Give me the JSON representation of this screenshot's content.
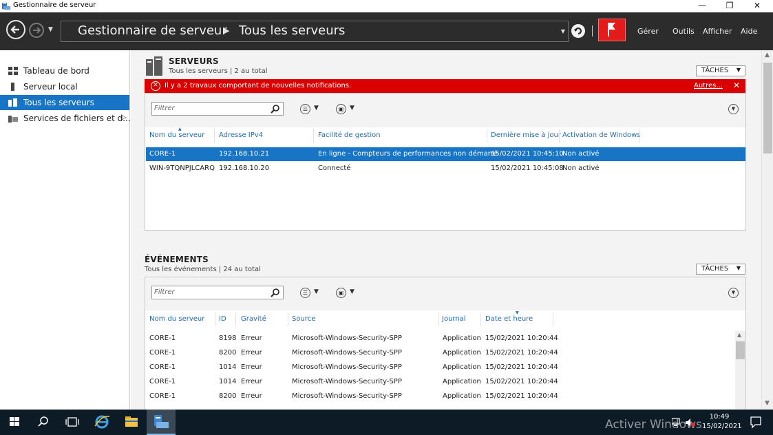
{
  "window": {
    "title": "Gestionnaire de serveur",
    "controls": {
      "minimize": "—",
      "maximize": "❐",
      "close": "✕"
    }
  },
  "header": {
    "breadcrumb": [
      "Gestionnaire de serveur",
      "Tous les serveurs"
    ],
    "menu": [
      "Gérer",
      "Outils",
      "Afficher",
      "Aide"
    ]
  },
  "sidebar": {
    "items": [
      {
        "label": "Tableau de bord",
        "icon": "dashboard-icon",
        "active": false
      },
      {
        "label": "Serveur local",
        "icon": "server-icon",
        "active": false
      },
      {
        "label": "Tous les serveurs",
        "icon": "servers-icon",
        "active": true
      },
      {
        "label": "Services de fichiers et d...",
        "icon": "file-services-icon",
        "active": false,
        "expandable": true
      }
    ]
  },
  "servers": {
    "title": "SERVEURS",
    "subtitle": "Tous les serveurs | 2 au total",
    "tasks_label": "TÂCHES",
    "alert": {
      "message": "Il y a 2 travaux comportant de nouvelles notifications.",
      "more": "Autres...",
      "close": "✕"
    },
    "filter_placeholder": "Filtrer",
    "columns": [
      "Nom du serveur",
      "Adresse IPv4",
      "Facilité de gestion",
      "Dernière mise à jour",
      "Activation de Windows"
    ],
    "rows": [
      {
        "name": "CORE-1",
        "ip": "192.168.10.21",
        "manageability": "En ligne - Compteurs de performances non démarré",
        "updated": "15/02/2021 10:45:10",
        "activation": "Non activé",
        "selected": true
      },
      {
        "name": "WIN-9TQNPJLCARQ",
        "ip": "192.168.10.20",
        "manageability": "Connecté",
        "updated": "15/02/2021 10:45:08",
        "activation": "Non activé",
        "selected": false
      }
    ]
  },
  "events": {
    "title": "ÉVÉNEMENTS",
    "subtitle": "Tous les événements | 24 au total",
    "tasks_label": "TÂCHES",
    "filter_placeholder": "Filtrer",
    "columns": [
      "Nom du serveur",
      "ID",
      "Gravité",
      "Source",
      "Journal",
      "Date et heure"
    ],
    "rows": [
      {
        "name": "CORE-1",
        "id": "8198",
        "severity": "Erreur",
        "source": "Microsoft-Windows-Security-SPP",
        "log": "Application",
        "date": "15/02/2021 10:20:44"
      },
      {
        "name": "CORE-1",
        "id": "8200",
        "severity": "Erreur",
        "source": "Microsoft-Windows-Security-SPP",
        "log": "Application",
        "date": "15/02/2021 10:20:44"
      },
      {
        "name": "CORE-1",
        "id": "1014",
        "severity": "Erreur",
        "source": "Microsoft-Windows-Security-SPP",
        "log": "Application",
        "date": "15/02/2021 10:20:44"
      },
      {
        "name": "CORE-1",
        "id": "1014",
        "severity": "Erreur",
        "source": "Microsoft-Windows-Security-SPP",
        "log": "Application",
        "date": "15/02/2021 10:20:44"
      },
      {
        "name": "CORE-1",
        "id": "8200",
        "severity": "Erreur",
        "source": "Microsoft-Windows-Security-SPP",
        "log": "Application",
        "date": "15/02/2021 10:20:44"
      }
    ]
  },
  "taskbar": {
    "watermark": "Activer Windows",
    "time": "10:49",
    "date": "15/02/2021"
  },
  "colors": {
    "header_bg": "#2c2c2c",
    "accent_blue": "#1874c4",
    "alert_red": "#da0000",
    "flag_red": "#e31b1b",
    "taskbar_bg": "#0d1b26"
  }
}
